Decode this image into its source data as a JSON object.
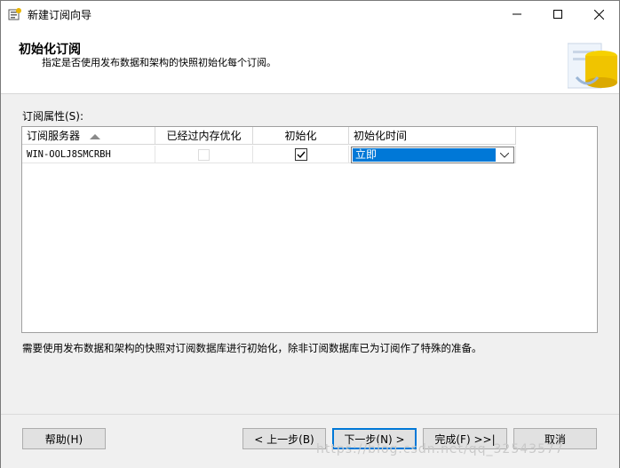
{
  "window": {
    "title": "新建订阅向导"
  },
  "header": {
    "title": "初始化订阅",
    "subtitle": "指定是否使用发布数据和架构的快照初始化每个订阅。"
  },
  "grid": {
    "label": "订阅属性(S):",
    "columns": {
      "server": "订阅服务器",
      "memopt": "已经过内存优化",
      "init": "初始化",
      "init_time": "初始化时间"
    },
    "rows": [
      {
        "server": "WIN-OOLJ8SMCRBH",
        "memopt_checked": false,
        "init_checked": true,
        "init_time": "立即"
      }
    ]
  },
  "note": "需要使用发布数据和架构的快照对订阅数据库进行初始化，除非订阅数据库已为订阅作了特殊的准备。",
  "buttons": {
    "help": "帮助(H)",
    "back": "< 上一步(B)",
    "next": "下一步(N) >",
    "finish": "完成(F) >>|",
    "cancel": "取消"
  },
  "watermark": "https://blog.csdn.net/qq_32543577",
  "colors": {
    "accent": "#0078d7",
    "selection": "#0078d7"
  }
}
